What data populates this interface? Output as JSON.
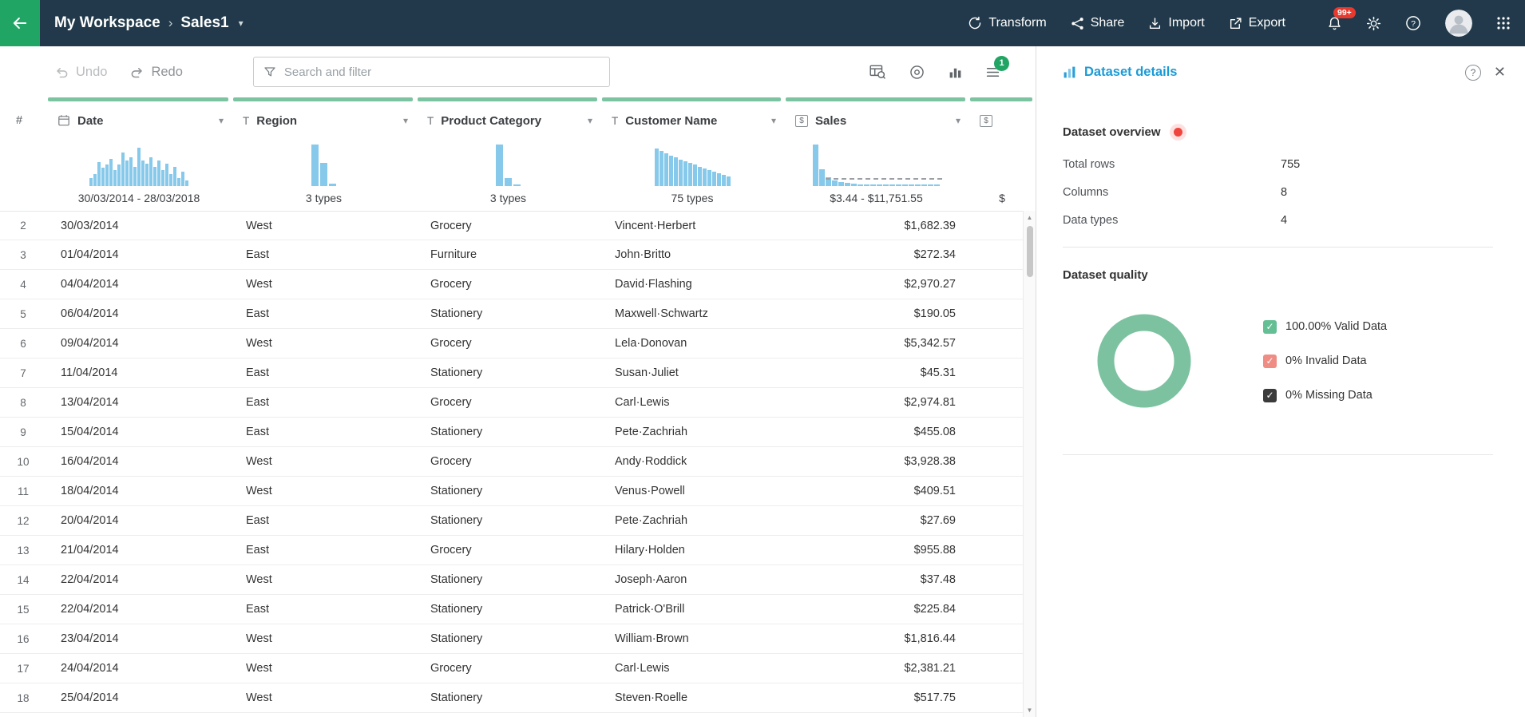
{
  "nav": {
    "workspace": "My Workspace",
    "dataset": "Sales1",
    "actions": [
      {
        "label": "Transform"
      },
      {
        "label": "Share"
      },
      {
        "label": "Import"
      },
      {
        "label": "Export"
      }
    ],
    "notification_count": "99+"
  },
  "toolbar": {
    "undo_label": "Undo",
    "redo_label": "Redo",
    "search_placeholder": "Search and filter",
    "steps_badge": "1"
  },
  "icons": {
    "caret_down": "▾",
    "breadcrumb_sep": "›",
    "help": "?",
    "close": "✕",
    "scroll_up": "▲",
    "scroll_down": "▼",
    "text_type": "T",
    "number_type": "$",
    "check": "✓"
  },
  "table": {
    "row_number_header": "#",
    "columns": [
      {
        "name": "Date",
        "type": "date",
        "summary_label": "30/03/2014 - 28/03/2018",
        "histogram": [
          20,
          28,
          58,
          44,
          52,
          66,
          38,
          52,
          80,
          62,
          70,
          46,
          92,
          62,
          54,
          70,
          46,
          62,
          38,
          54,
          28,
          46,
          20,
          34,
          14
        ]
      },
      {
        "name": "Region",
        "type": "text",
        "summary_label": "3 types",
        "histogram": [
          100,
          55,
          6
        ]
      },
      {
        "name": "Product Category",
        "type": "text",
        "summary_label": "3 types",
        "histogram": [
          100,
          20,
          4
        ]
      },
      {
        "name": "Customer Name",
        "type": "text",
        "summary_label": "75 types",
        "histogram": [
          90,
          84,
          79,
          74,
          69,
          64,
          59,
          55,
          51,
          47,
          43,
          39,
          35,
          31,
          27,
          23
        ]
      },
      {
        "name": "Sales",
        "type": "number",
        "summary_label": "$3.44 - $11,751.55",
        "align": "right",
        "histogram": [
          100,
          40,
          22,
          13,
          9,
          7,
          5,
          4,
          3,
          3,
          2,
          2,
          2,
          2,
          1,
          1,
          1,
          1,
          1,
          1
        ],
        "dashed_marker": true
      }
    ],
    "partial_column": {
      "type": "number",
      "summary_label": "$"
    },
    "rows": [
      {
        "n": "2",
        "cells": [
          "30/03/2014",
          "West",
          "Grocery",
          "Vincent·Herbert",
          "$1,682.39"
        ]
      },
      {
        "n": "3",
        "cells": [
          "01/04/2014",
          "East",
          "Furniture",
          "John·Britto",
          "$272.34"
        ]
      },
      {
        "n": "4",
        "cells": [
          "04/04/2014",
          "West",
          "Grocery",
          "David·Flashing",
          "$2,970.27"
        ]
      },
      {
        "n": "5",
        "cells": [
          "06/04/2014",
          "East",
          "Stationery",
          "Maxwell·Schwartz",
          "$190.05"
        ]
      },
      {
        "n": "6",
        "cells": [
          "09/04/2014",
          "West",
          "Grocery",
          "Lela·Donovan",
          "$5,342.57"
        ]
      },
      {
        "n": "7",
        "cells": [
          "11/04/2014",
          "East",
          "Stationery",
          "Susan·Juliet",
          "$45.31"
        ]
      },
      {
        "n": "8",
        "cells": [
          "13/04/2014",
          "East",
          "Grocery",
          "Carl·Lewis",
          "$2,974.81"
        ]
      },
      {
        "n": "9",
        "cells": [
          "15/04/2014",
          "East",
          "Stationery",
          "Pete·Zachriah",
          "$455.08"
        ]
      },
      {
        "n": "10",
        "cells": [
          "16/04/2014",
          "West",
          "Grocery",
          "Andy·Roddick",
          "$3,928.38"
        ]
      },
      {
        "n": "11",
        "cells": [
          "18/04/2014",
          "West",
          "Stationery",
          "Venus·Powell",
          "$409.51"
        ]
      },
      {
        "n": "12",
        "cells": [
          "20/04/2014",
          "East",
          "Stationery",
          "Pete·Zachriah",
          "$27.69"
        ]
      },
      {
        "n": "13",
        "cells": [
          "21/04/2014",
          "East",
          "Grocery",
          "Hilary·Holden",
          "$955.88"
        ]
      },
      {
        "n": "14",
        "cells": [
          "22/04/2014",
          "West",
          "Stationery",
          "Joseph·Aaron",
          "$37.48"
        ]
      },
      {
        "n": "15",
        "cells": [
          "22/04/2014",
          "East",
          "Stationery",
          "Patrick·O'Brill",
          "$225.84"
        ]
      },
      {
        "n": "16",
        "cells": [
          "23/04/2014",
          "West",
          "Stationery",
          "William·Brown",
          "$1,816.44"
        ]
      },
      {
        "n": "17",
        "cells": [
          "24/04/2014",
          "West",
          "Grocery",
          "Carl·Lewis",
          "$2,381.21"
        ]
      },
      {
        "n": "18",
        "cells": [
          "25/04/2014",
          "West",
          "Stationery",
          "Steven·Roelle",
          "$517.75"
        ]
      }
    ]
  },
  "panel": {
    "title": "Dataset details",
    "overview_title": "Dataset overview",
    "stats": [
      {
        "label": "Total rows",
        "value": "755"
      },
      {
        "label": "Columns",
        "value": "8"
      },
      {
        "label": "Data types",
        "value": "4"
      }
    ],
    "quality_title": "Dataset quality",
    "donut_percent": 100,
    "quality_legend": [
      {
        "label": "100.00% Valid Data",
        "color": "#64bf95"
      },
      {
        "label": "0% Invalid Data",
        "color": "#ef8d85"
      },
      {
        "label": "0% Missing Data",
        "color": "#3b3b3b"
      }
    ]
  },
  "colors": {
    "navbar_bg": "#21394a",
    "accent_green": "#21a565",
    "strip_green": "#7cc3a1",
    "histogram_blue": "#87c9ea",
    "link_blue": "#1b9ad6",
    "donut_green": "#7cc2a0",
    "badge_red": "#e8392e"
  }
}
